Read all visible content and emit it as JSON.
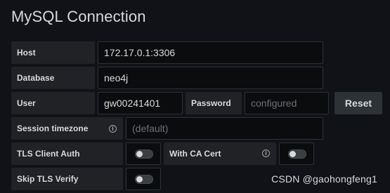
{
  "title": "MySQL Connection",
  "fields": {
    "host": {
      "label": "Host",
      "value": "172.17.0.1:3306"
    },
    "database": {
      "label": "Database",
      "value": "neo4j"
    },
    "user": {
      "label": "User",
      "value": "gw00241401"
    },
    "password": {
      "label": "Password",
      "placeholder": "configured"
    },
    "session_timezone": {
      "label": "Session timezone",
      "placeholder": "(default)"
    },
    "tls_client_auth": {
      "label": "TLS Client Auth",
      "enabled": false
    },
    "with_ca_cert": {
      "label": "With CA Cert",
      "enabled": false
    },
    "skip_tls_verify": {
      "label": "Skip TLS Verify",
      "enabled": false
    }
  },
  "buttons": {
    "reset": "Reset"
  },
  "icons": {
    "info": "info-icon"
  },
  "watermark": "CSDN @gaohongfeng1",
  "colors": {
    "background": "#111217",
    "label_bg": "#202226",
    "input_bg": "#0b0c0e",
    "border": "#2c3235",
    "text": "#d8d9da"
  }
}
